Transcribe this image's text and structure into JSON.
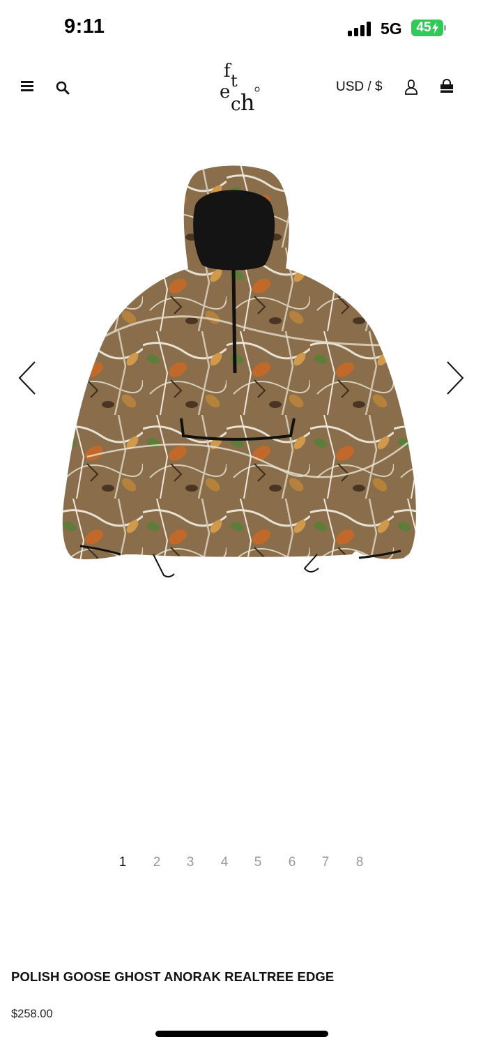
{
  "status_bar": {
    "time": "9:11",
    "network": "5G",
    "battery": "45",
    "signal_icon": "signal-bars-icon",
    "battery_icon": "battery-charging-icon"
  },
  "header": {
    "menu_icon": "hamburger-menu-icon",
    "search_icon": "search-icon",
    "logo_text": "fetch",
    "currency": "USD / $",
    "account_icon": "user-icon",
    "bag_icon": "shopping-bag-icon"
  },
  "gallery": {
    "prev_icon": "chevron-left-icon",
    "next_icon": "chevron-right-icon",
    "image_subject": "camouflage-anorak-jacket",
    "pages": [
      "1",
      "2",
      "3",
      "4",
      "5",
      "6",
      "7",
      "8"
    ],
    "active_page": "1"
  },
  "product": {
    "title": "POLISH GOOSE GHOST ANORAK REALTREE EDGE",
    "price": "$258.00"
  },
  "colors": {
    "text": "#111111",
    "muted": "#9a9a9a",
    "battery": "#34c759",
    "camo_base": "#8a6d4a",
    "camo_orange": "#c0692a",
    "camo_green": "#5f7d3a"
  }
}
